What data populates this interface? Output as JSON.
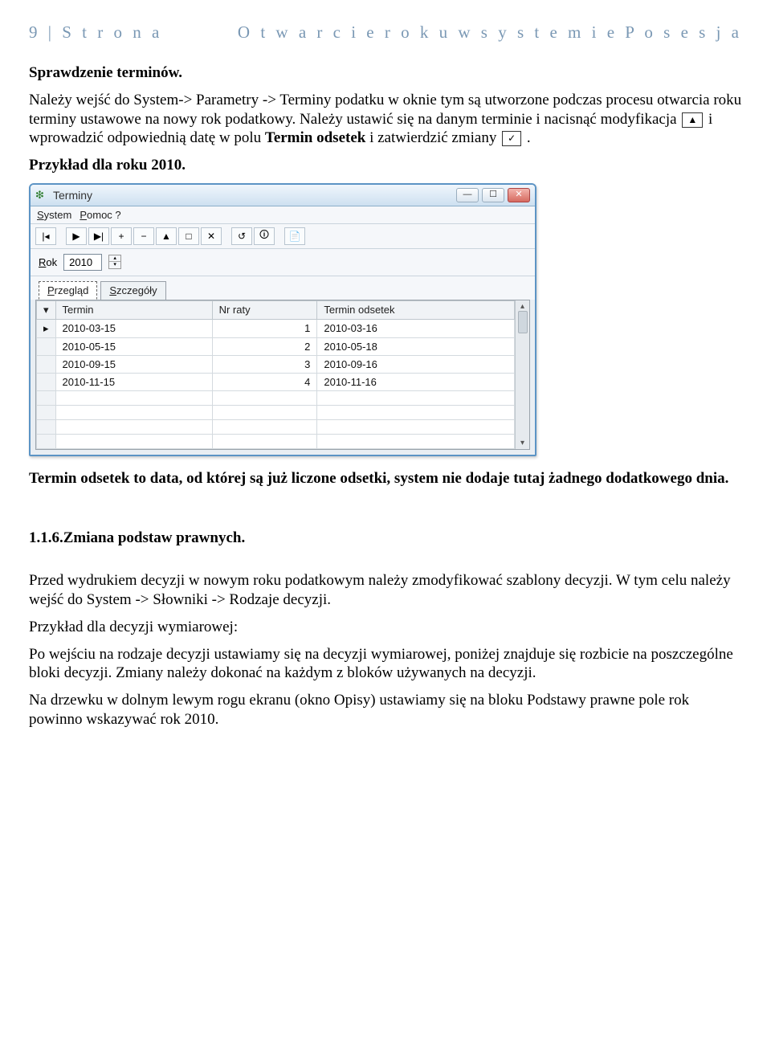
{
  "header": {
    "left": "9 | S t r o n a",
    "right": "O t w a r c i e   r o k u   w   s y s t e m i e   P o s e s j a"
  },
  "text": {
    "h1": "Sprawdzenie terminów.",
    "p1a": "Należy wejść do System-> Parametry -> Terminy podatku w oknie tym są utworzone podczas procesu otwarcia roku terminy ustawowe na nowy rok podatkowy. Należy ustawić się na danym terminie i nacisnąć modyfikacja ",
    "p1b": " i wprowadzić  odpowiednią datę w polu ",
    "p1c": "Termin odsetek",
    "p1d": " i zatwierdzić zmiany ",
    "p1e": ".",
    "p2": "Przykład dla roku 2010.",
    "p3": "Termin odsetek to data, od której są już liczone odsetki, system nie dodaje tutaj żadnego dodatkowego dnia.",
    "h2": "1.1.6.Zmiana podstaw prawnych.",
    "p4a": "Przed wydrukiem decyzji w  nowym roku podatkowym należy zmodyfikować szablony decyzji. W tym celu należy wejść do System -> Słowniki -> Rodzaje decyzji.",
    "p5": "Przykład dla decyzji wymiarowej:",
    "p6": "Po wejściu na rodzaje decyzji ustawiamy się na decyzji wymiarowej, poniżej znajduje się rozbicie na poszczególne bloki decyzji. Zmiany należy dokonać na każdym z bloków używanych na decyzji.",
    "p7": "Na drzewku w dolnym lewym rogu ekranu (okno Opisy) ustawiamy się na bloku Podstawy prawne  pole rok powinno wskazywać rok 2010."
  },
  "window": {
    "title": "Terminy",
    "menu": {
      "system": "System",
      "pomoc": "Pomoc ?"
    },
    "toolbar_icons": [
      "|◂",
      "▶",
      "▶|",
      "+",
      "−",
      "▲",
      "□",
      "✕",
      "↺",
      "🛈",
      "📄"
    ],
    "rok_label": "Rok",
    "rok_value": "2010",
    "tabs": {
      "przeglad": "Przegląd",
      "szczegoly": "Szczegóły"
    },
    "columns": {
      "c0": "▾",
      "c1": "Termin",
      "c2": "Nr raty",
      "c3": "Termin odsetek"
    },
    "rows": [
      {
        "mark": "▸",
        "termin": "2010-03-15",
        "nr": "1",
        "odsetek": "2010-03-16"
      },
      {
        "mark": "",
        "termin": "2010-05-15",
        "nr": "2",
        "odsetek": "2010-05-18"
      },
      {
        "mark": "",
        "termin": "2010-09-15",
        "nr": "3",
        "odsetek": "2010-09-16"
      },
      {
        "mark": "",
        "termin": "2010-11-15",
        "nr": "4",
        "odsetek": "2010-11-16"
      }
    ],
    "scroll": {
      "up": "▴",
      "down": "▾"
    },
    "winbtns": {
      "min": "—",
      "max": "☐",
      "close": "✕"
    }
  },
  "inline": {
    "edit_icon": "▲",
    "confirm_icon": "✓"
  }
}
